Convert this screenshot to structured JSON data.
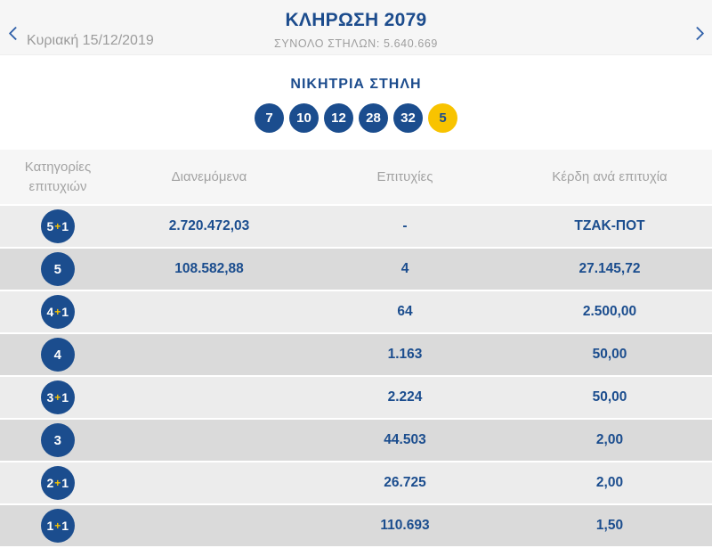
{
  "header": {
    "title": "ΚΛΗΡΩΣΗ 2079",
    "subtitle": "ΣΥΝΟΛΟ ΣΤΗΛΩΝ: 5.640.669",
    "date": "Κυριακή 15/12/2019"
  },
  "winning": {
    "section_title": "ΝΙΚΗΤΡΙΑ ΣΤΗΛΗ",
    "numbers": [
      "7",
      "10",
      "12",
      "28",
      "32"
    ],
    "joker": "5"
  },
  "table": {
    "headers": {
      "category": "Κατηγορίες επιτυχιών",
      "distributed": "Διανεμόμενα",
      "winners": "Επιτυχίες",
      "prize": "Κέρδη ανά επιτυχία"
    },
    "rows": [
      {
        "category": "5+1",
        "distributed": "2.720.472,03",
        "winners": "-",
        "prize": "ΤΖΑΚ-ΠΟΤ"
      },
      {
        "category": "5",
        "distributed": "108.582,88",
        "winners": "4",
        "prize": "27.145,72"
      },
      {
        "category": "4+1",
        "distributed": "",
        "winners": "64",
        "prize": "2.500,00"
      },
      {
        "category": "4",
        "distributed": "",
        "winners": "1.163",
        "prize": "50,00"
      },
      {
        "category": "3+1",
        "distributed": "",
        "winners": "2.224",
        "prize": "50,00"
      },
      {
        "category": "3",
        "distributed": "",
        "winners": "44.503",
        "prize": "2,00"
      },
      {
        "category": "2+1",
        "distributed": "",
        "winners": "26.725",
        "prize": "2,00"
      },
      {
        "category": "1+1",
        "distributed": "",
        "winners": "110.693",
        "prize": "1,50"
      }
    ]
  },
  "colors": {
    "navy": "#1b4d8e",
    "yellow": "#f8c300",
    "row_light": "#ececec",
    "row_dark": "#dadada",
    "strip_bg": "#f6f6f6",
    "muted_text": "#9e9e9e"
  }
}
